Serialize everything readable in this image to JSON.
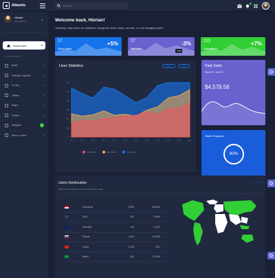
{
  "app": {
    "name": "Atlantis"
  },
  "search": {
    "placeholder": "Search ..."
  },
  "user": {
    "name": "Hizrian",
    "role": "Administrator"
  },
  "sidebar": {
    "active": "Dashboard",
    "section_label": "COMPONENTS",
    "items": [
      {
        "label": "Base",
        "icon": "layers-icon"
      },
      {
        "label": "Sidebar Layouts",
        "icon": "th-list-icon"
      },
      {
        "label": "Forms",
        "icon": "pen-icon"
      },
      {
        "label": "Tables",
        "icon": "table-icon"
      },
      {
        "label": "Maps",
        "icon": "map-marker-icon"
      },
      {
        "label": "Charts",
        "icon": "chart-icon"
      },
      {
        "label": "Widgets",
        "icon": "desktop-icon",
        "badge": "4"
      },
      {
        "label": "Menu Levels",
        "icon": "bars-icon"
      }
    ]
  },
  "header": {
    "title": "Welcome back, Hizrian!",
    "subtitle": "Yesterday I was clever, so I wanted to change the world. Today I am wise, so I am changing myself."
  },
  "stats": [
    {
      "value": "17",
      "label": "Users Online",
      "change": "+5%",
      "color": "#1572e8"
    },
    {
      "value": "27",
      "label": "New Users",
      "change": "-3%",
      "color": "#6861ce",
      "tooltip": "• 778"
    },
    {
      "value": "213",
      "label": "Transactions",
      "change": "+7%",
      "color": "#31ce36"
    }
  ],
  "user_statistics": {
    "title": "User Statistics",
    "export_label": "Export",
    "print_label": "Print",
    "legend": [
      "Subscribers",
      "New Visitors",
      "Active Users"
    ]
  },
  "chart_data": {
    "type": "area",
    "categories": [
      "Jan",
      "Feb",
      "Mar",
      "Apr",
      "May",
      "Jun",
      "Jul",
      "Aug",
      "Sep",
      "Oct",
      "Nov",
      "Dec"
    ],
    "ylim": [
      0,
      600
    ],
    "yticks": [
      0,
      100,
      200,
      300,
      400,
      500,
      600
    ],
    "series": [
      {
        "name": "Subscribers",
        "color": "#f3545d",
        "values": [
          154,
          184,
          175,
          203,
          210,
          231,
          240,
          278,
          252,
          312,
          320,
          374
        ]
      },
      {
        "name": "New Visitors",
        "color": "#fdaf4b",
        "values": [
          256,
          230,
          245,
          287,
          240,
          250,
          230,
          295,
          331,
          431,
          456,
          521
        ]
      },
      {
        "name": "Active Users",
        "color": "#177dff",
        "values": [
          542,
          480,
          430,
          550,
          530,
          453,
          380,
          434,
          568,
          610,
          700,
          900
        ]
      }
    ]
  },
  "daily_sales": {
    "title": "Daily Sales",
    "date": "March 25 - April 02",
    "value": "$4,578.58"
  },
  "tasks": {
    "title": "Tasks Progress",
    "value": "80%"
  },
  "geo": {
    "title": "Users Geolocation",
    "subtitle": "Map of the distribution of users around the world",
    "rows": [
      {
        "country": "Indonesia",
        "users": "2.550",
        "pct": "68.98%",
        "flag": "#e00"
      },
      {
        "country": "USA",
        "users": "149",
        "pct": "4.06%",
        "flag": "#3c3b6e"
      },
      {
        "country": "Australia",
        "users": "119",
        "pct": "3.16%",
        "flag": "#012169"
      },
      {
        "country": "Russia",
        "users": "1,081",
        "pct": "19.65%",
        "flag": "#0039a6"
      },
      {
        "country": "China",
        "users": "1,100",
        "pct": "20%",
        "flag": "#de2910"
      },
      {
        "country": "Brasil",
        "users": "640",
        "pct": "11.63%",
        "flag": "#009c3b"
      }
    ]
  }
}
